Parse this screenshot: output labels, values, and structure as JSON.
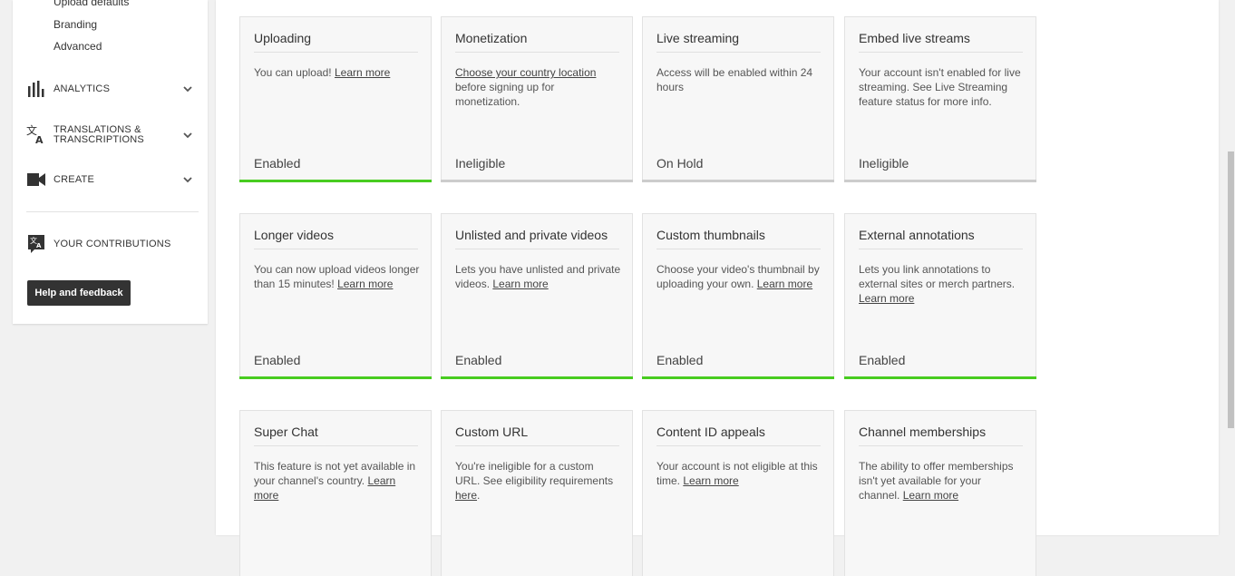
{
  "sidebar": {
    "sub_links": [
      "Upload defaults",
      "Branding",
      "Advanced"
    ],
    "analytics": "ANALYTICS",
    "translations_line1": "TRANSLATIONS &",
    "translations_line2": "TRANSCRIPTIONS",
    "create": "CREATE",
    "contributions": "YOUR CONTRIBUTIONS",
    "help_button": "Help and feedback"
  },
  "colors": {
    "enabled": "#48cc20",
    "other": "#cccccc"
  },
  "cards": [
    {
      "title": "Uploading",
      "desc_html": "You can upload! <a>Learn more</a>",
      "status": "Enabled",
      "bar": "enabled"
    },
    {
      "title": "Monetization",
      "desc_html": "<a>Choose your country location</a> before signing up for monetization.",
      "status": "Ineligible",
      "bar": "other"
    },
    {
      "title": "Live streaming",
      "desc_html": "Access will be enabled within 24 hours",
      "status": "On Hold",
      "bar": "other"
    },
    {
      "title": "Embed live streams",
      "desc_html": "Your account isn't enabled for live streaming. See Live Streaming feature status for more info.",
      "status": "Ineligible",
      "bar": "other"
    },
    {
      "title": "Longer videos",
      "desc_html": "You can now upload videos longer than 15 minutes! <a>Learn more</a>",
      "status": "Enabled",
      "bar": "enabled"
    },
    {
      "title": "Unlisted and private videos",
      "desc_html": "Lets you have unlisted and private videos. <a>Learn more</a>",
      "status": "Enabled",
      "bar": "enabled"
    },
    {
      "title": "Custom thumbnails",
      "desc_html": "Choose your video's thumbnail by uploading your own. <a>Learn more</a>",
      "status": "Enabled",
      "bar": "enabled"
    },
    {
      "title": "External annotations",
      "desc_html": "Lets you link annotations to external sites or merch partners. <a>Learn more</a>",
      "status": "Enabled",
      "bar": "enabled"
    },
    {
      "title": "Super Chat",
      "desc_html": "This feature is not yet available in your channel's country. <a>Learn more</a>",
      "status": "",
      "bar": "none"
    },
    {
      "title": "Custom URL",
      "desc_html": "You're ineligible for a custom URL. See eligibility requirements <a>here</a>.",
      "status": "",
      "bar": "none"
    },
    {
      "title": "Content ID appeals",
      "desc_html": "Your account is not eligible at this time. <a>Learn more</a>",
      "status": "",
      "bar": "none"
    },
    {
      "title": "Channel memberships",
      "desc_html": "The ability to offer memberships isn't yet available for your channel. <a>Learn more</a>",
      "status": "",
      "bar": "none"
    }
  ]
}
